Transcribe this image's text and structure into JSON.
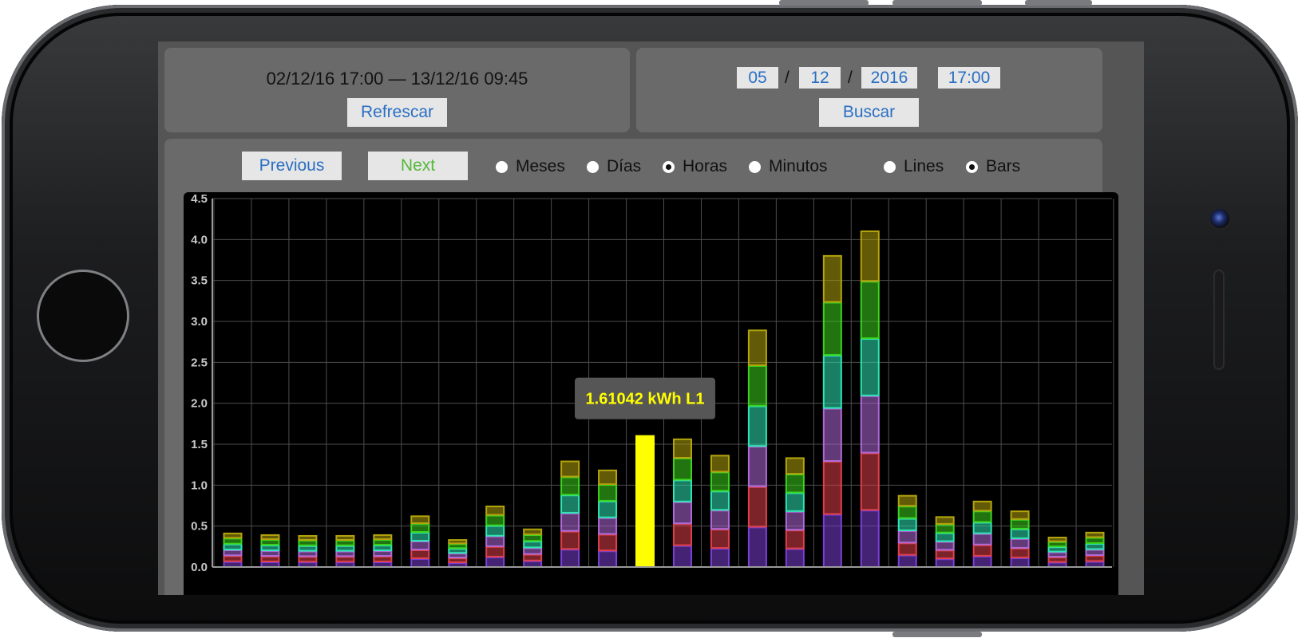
{
  "header": {
    "range_text": "02/12/16 17:00 — 13/12/16 09:45",
    "refresh_label": "Refrescar",
    "search_label": "Buscar",
    "date": {
      "day": "05",
      "month": "12",
      "year": "2016",
      "time": "17:00",
      "separator": "/"
    }
  },
  "controls": {
    "previous_label": "Previous",
    "next_label": "Next",
    "granularity": [
      {
        "label": "Meses",
        "checked": false
      },
      {
        "label": "Días",
        "checked": false
      },
      {
        "label": "Horas",
        "checked": true
      },
      {
        "label": "Minutos",
        "checked": false
      }
    ],
    "mode": [
      {
        "label": "Lines",
        "checked": false
      },
      {
        "label": "Bars",
        "checked": true
      }
    ]
  },
  "tooltip": {
    "text": "1.61042 kWh L1"
  },
  "colors": {
    "background": "#555555",
    "panel": "#6a6a6a",
    "link_blue": "#2a6fc4",
    "next_green": "#55b83a",
    "highlight": "#ffff00",
    "series": [
      "#7b3fd6",
      "#e0404a",
      "#b06ad8",
      "#2ee6b4",
      "#3cd41e",
      "#b4a40c"
    ]
  },
  "chart_data": {
    "type": "bar",
    "stacked": true,
    "unit": "kWh",
    "ylim": [
      0,
      4.5
    ],
    "yticks": [
      "0.0",
      "0.5",
      "1.0",
      "1.5",
      "2.0",
      "2.5",
      "3.0",
      "3.5",
      "4.0",
      "4.5"
    ],
    "grid": true,
    "highlighted_index": 11,
    "highlighted_value": 1.61042,
    "totals": [
      0.42,
      0.4,
      0.39,
      0.39,
      0.4,
      0.63,
      0.34,
      0.75,
      0.47,
      1.3,
      1.19,
      1.61,
      1.57,
      1.37,
      2.9,
      1.34,
      3.81,
      4.11,
      0.88,
      0.62,
      0.81,
      0.69,
      0.37,
      0.43
    ],
    "series_shares": [
      0.17,
      0.17,
      0.17,
      0.17,
      0.17,
      0.15
    ]
  }
}
